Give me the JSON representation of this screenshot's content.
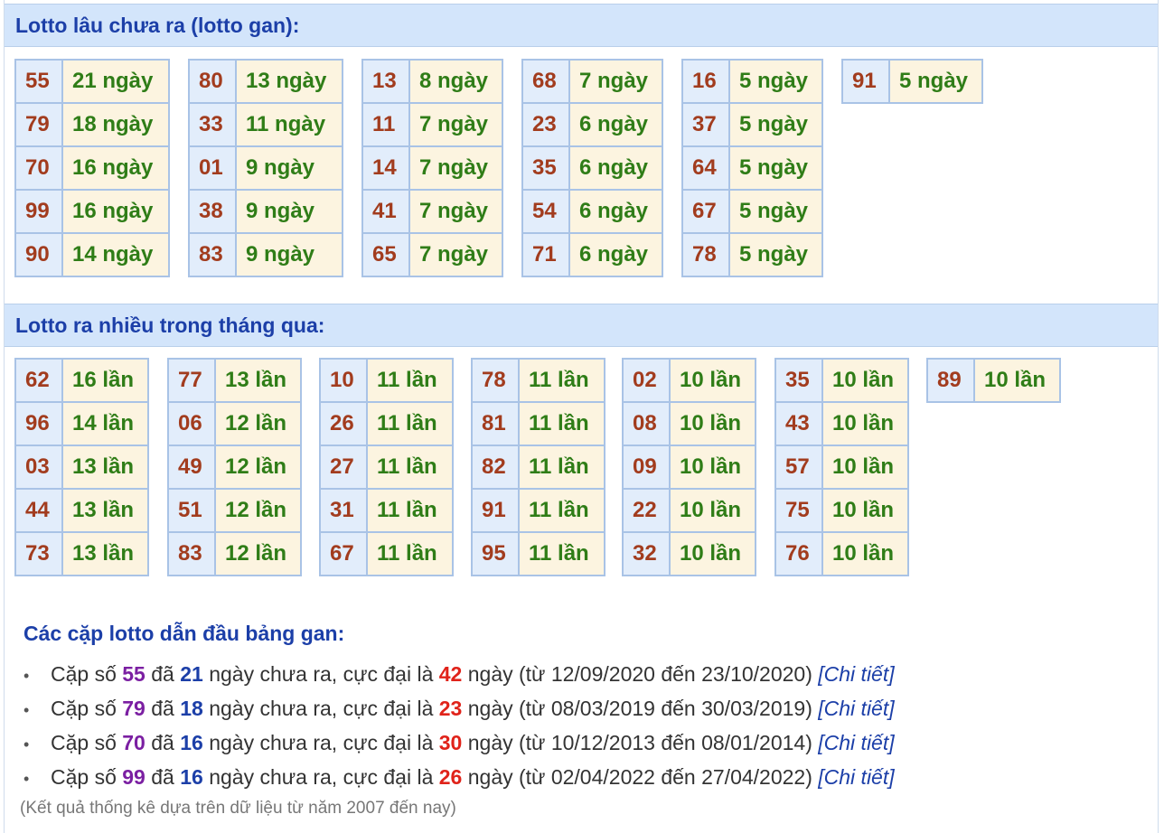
{
  "gan": {
    "title": "Lotto lâu chưa ra (lotto gan):",
    "columns": [
      [
        [
          "55",
          "21 ngày"
        ],
        [
          "79",
          "18 ngày"
        ],
        [
          "70",
          "16 ngày"
        ],
        [
          "99",
          "16 ngày"
        ],
        [
          "90",
          "14 ngày"
        ]
      ],
      [
        [
          "80",
          "13 ngày"
        ],
        [
          "33",
          "11 ngày"
        ],
        [
          "01",
          "9 ngày"
        ],
        [
          "38",
          "9 ngày"
        ],
        [
          "83",
          "9 ngày"
        ]
      ],
      [
        [
          "13",
          "8 ngày"
        ],
        [
          "11",
          "7 ngày"
        ],
        [
          "14",
          "7 ngày"
        ],
        [
          "41",
          "7 ngày"
        ],
        [
          "65",
          "7 ngày"
        ]
      ],
      [
        [
          "68",
          "7 ngày"
        ],
        [
          "23",
          "6 ngày"
        ],
        [
          "35",
          "6 ngày"
        ],
        [
          "54",
          "6 ngày"
        ],
        [
          "71",
          "6 ngày"
        ]
      ],
      [
        [
          "16",
          "5 ngày"
        ],
        [
          "37",
          "5 ngày"
        ],
        [
          "64",
          "5 ngày"
        ],
        [
          "67",
          "5 ngày"
        ],
        [
          "78",
          "5 ngày"
        ]
      ],
      [
        [
          "91",
          "5 ngày"
        ]
      ]
    ]
  },
  "frequent": {
    "title": "Lotto ra nhiều trong tháng qua:",
    "columns": [
      [
        [
          "62",
          "16 lần"
        ],
        [
          "96",
          "14 lần"
        ],
        [
          "03",
          "13 lần"
        ],
        [
          "44",
          "13 lần"
        ],
        [
          "73",
          "13 lần"
        ]
      ],
      [
        [
          "77",
          "13 lần"
        ],
        [
          "06",
          "12 lần"
        ],
        [
          "49",
          "12 lần"
        ],
        [
          "51",
          "12 lần"
        ],
        [
          "83",
          "12 lần"
        ]
      ],
      [
        [
          "10",
          "11 lần"
        ],
        [
          "26",
          "11 lần"
        ],
        [
          "27",
          "11 lần"
        ],
        [
          "31",
          "11 lần"
        ],
        [
          "67",
          "11 lần"
        ]
      ],
      [
        [
          "78",
          "11 lần"
        ],
        [
          "81",
          "11 lần"
        ],
        [
          "82",
          "11 lần"
        ],
        [
          "91",
          "11 lần"
        ],
        [
          "95",
          "11 lần"
        ]
      ],
      [
        [
          "02",
          "10 lần"
        ],
        [
          "08",
          "10 lần"
        ],
        [
          "09",
          "10 lần"
        ],
        [
          "22",
          "10 lần"
        ],
        [
          "32",
          "10 lần"
        ]
      ],
      [
        [
          "35",
          "10 lần"
        ],
        [
          "43",
          "10 lần"
        ],
        [
          "57",
          "10 lần"
        ],
        [
          "75",
          "10 lần"
        ],
        [
          "76",
          "10 lần"
        ]
      ],
      [
        [
          "89",
          "10 lần"
        ]
      ]
    ]
  },
  "leaders": {
    "title": "Các cặp lotto dẫn đầu bảng gan:",
    "items": [
      {
        "pair": "55",
        "days": "21",
        "max": "42",
        "from": "12/09/2020",
        "to": "23/10/2020"
      },
      {
        "pair": "79",
        "days": "18",
        "max": "23",
        "from": "08/03/2019",
        "to": "30/03/2019"
      },
      {
        "pair": "70",
        "days": "16",
        "max": "30",
        "from": "10/12/2013",
        "to": "08/01/2014"
      },
      {
        "pair": "99",
        "days": "16",
        "max": "26",
        "from": "02/04/2022",
        "to": "27/04/2022"
      }
    ],
    "text": {
      "prefix": "Cặp số",
      "da": "đã",
      "middle": "ngày chưa ra, cực đại là",
      "ngay_tu": "ngày (từ",
      "den": "đến",
      "close": ")",
      "link": "[Chi tiết]"
    }
  },
  "note": "(Kết quả thống kê dựa trên dữ liệu từ năm 2007 đến nay)",
  "colors": {
    "header_bg": "#d3e5fb",
    "title_blue": "#1c3fa8",
    "number_red": "#a23c1e",
    "value_green": "#2f7d17",
    "pair_purple": "#7b1fa2",
    "max_red": "#e0231a"
  }
}
